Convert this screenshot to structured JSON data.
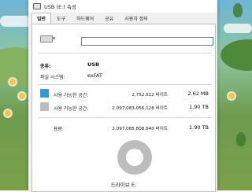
{
  "window": {
    "title": "USB (E:) 속성"
  },
  "tabs": [
    {
      "label": "일반",
      "active": true
    },
    {
      "label": "도구"
    },
    {
      "label": "하드웨어"
    },
    {
      "label": "공유"
    },
    {
      "label": "사용자 정의"
    }
  ],
  "drive": {
    "icon": "usb-drive-icon",
    "name_value": ""
  },
  "props": {
    "type_label": "종류:",
    "type_value": "USB",
    "fs_label": "파일 시스템:",
    "fs_value": "exFAT"
  },
  "space": {
    "used_label": "사용 가능한 공간:",
    "used_bytes": "2,752,512 바이트",
    "used_size": "2.62 MB",
    "used_color": "#26a0da",
    "free_label": "사용 가능한 공간:",
    "free_bytes": "2,097,083,056,128 바이트",
    "free_size": "1.90 TB",
    "free_color": "#bdbdbd",
    "cap_label": "용량:",
    "cap_bytes": "2,097,085,808,640 바이트",
    "cap_size": "1.90 TB"
  },
  "drive_label": "드라이브 E:"
}
